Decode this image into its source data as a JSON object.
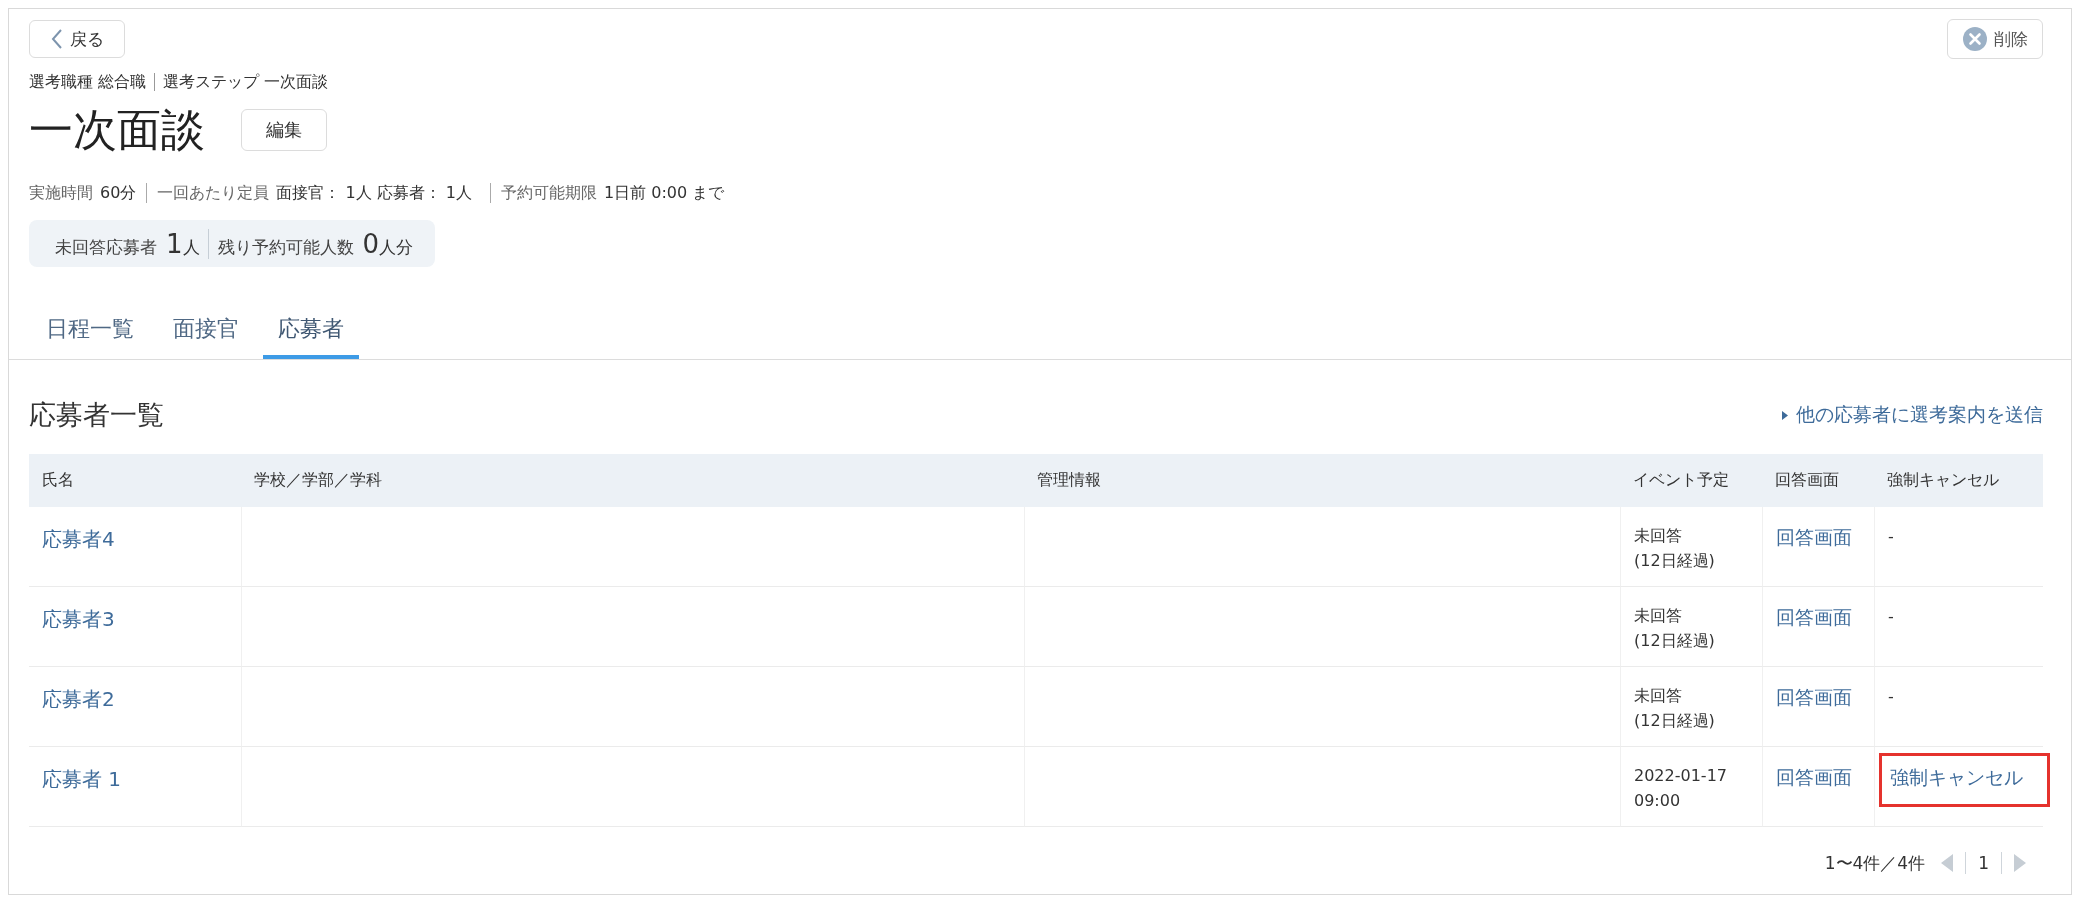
{
  "back_button": {
    "label": "戻る"
  },
  "delete_button": {
    "label": "削除"
  },
  "breadcrumb": [
    "選考職種 総合職",
    "選考ステップ 一次面談"
  ],
  "title": "一次面談",
  "edit_button": {
    "label": "編集"
  },
  "info": [
    {
      "label": "実施時間",
      "value": "60分"
    },
    {
      "label": "一回あたり定員",
      "value": "面接官： 1人 応募者： 1人"
    },
    {
      "label": "予約可能期限",
      "value": "1日前 0:00 まで"
    }
  ],
  "summary": [
    {
      "label": "未回答応募者",
      "count": "1",
      "unit": "人"
    },
    {
      "label": "残り予約可能人数",
      "count": "0",
      "unit": "人分"
    }
  ],
  "tabs": [
    {
      "label": "日程一覧",
      "selected": false
    },
    {
      "label": "面接官",
      "selected": false
    },
    {
      "label": "応募者",
      "selected": true
    }
  ],
  "section": {
    "title": "応募者一覧",
    "action_link": "他の応募者に選考案内を送信"
  },
  "table": {
    "columns": [
      "氏名",
      "学校／学部／学科",
      "管理情報",
      "イベント予定",
      "回答画面",
      "強制キャンセル"
    ],
    "rows": [
      {
        "name": "応募者4",
        "event": [
          "未回答",
          "(12日経過)"
        ],
        "answer_link": "回答画面",
        "cancel": {
          "kind": "dash",
          "label": "-",
          "highlighted": false
        }
      },
      {
        "name": "応募者3",
        "event": [
          "未回答",
          "(12日経過)"
        ],
        "answer_link": "回答画面",
        "cancel": {
          "kind": "dash",
          "label": "-",
          "highlighted": false
        }
      },
      {
        "name": "応募者2",
        "event": [
          "未回答",
          "(12日経過)"
        ],
        "answer_link": "回答画面",
        "cancel": {
          "kind": "dash",
          "label": "-",
          "highlighted": false
        }
      },
      {
        "name": "応募者 1",
        "event": [
          "2022-01-17",
          "09:00"
        ],
        "answer_link": "回答画面",
        "cancel": {
          "kind": "link",
          "label": "強制キャンセル",
          "highlighted": true
        }
      }
    ]
  },
  "pagination": {
    "range": "1〜4件／4件",
    "page": "1",
    "prev": {
      "disabled": true
    },
    "next": {
      "disabled": true
    }
  }
}
